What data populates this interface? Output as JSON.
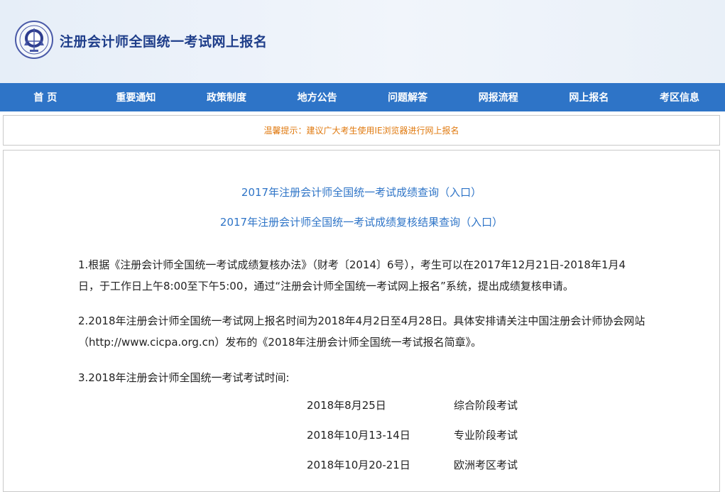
{
  "header": {
    "title": "注册会计师全国统一考试网上报名"
  },
  "nav": {
    "items": [
      {
        "label": "首 页"
      },
      {
        "label": "重要通知"
      },
      {
        "label": "政策制度"
      },
      {
        "label": "地方公告"
      },
      {
        "label": "问题解答"
      },
      {
        "label": "网报流程"
      },
      {
        "label": "网上报名"
      },
      {
        "label": "考区信息"
      }
    ]
  },
  "notice": {
    "text": "温馨提示：建议广大考生使用IE浏览器进行网上报名"
  },
  "main": {
    "links": [
      "2017年注册会计师全国统一考试成绩查询（入口）",
      "2017年注册会计师全国统一考试成绩复核结果查询（入口）"
    ],
    "para1": "1.根据《注册会计师全国统一考试成绩复核办法》（财考〔2014〕6号），考生可以在2017年12月21日-2018年1月4日，于工作日上午8:00至下午5:00，通过“注册会计师全国统一考试网上报名”系统，提出成绩复核申请。",
    "para2": "2.2018年注册会计师全国统一考试网上报名时间为2018年4月2日至4月28日。具体安排请关注中国注册会计师协会网站（http://www.cicpa.org.cn）发布的《2018年注册会计师全国统一考试报名简章》。",
    "para3": "3.2018年注册会计师全国统一考试考试时间:",
    "schedule": [
      {
        "date": "2018年8月25日",
        "label": "综合阶段考试"
      },
      {
        "date": "2018年10月13-14日",
        "label": "专业阶段考试"
      },
      {
        "date": "2018年10月20-21日",
        "label": "欧洲考区考试"
      }
    ]
  },
  "colors": {
    "nav_bg": "#2e74c7",
    "title": "#1f3e8a",
    "link": "#2e74c7",
    "notice": "#e07a10"
  },
  "icons": {
    "logo": "cicpa-emblem-icon"
  }
}
